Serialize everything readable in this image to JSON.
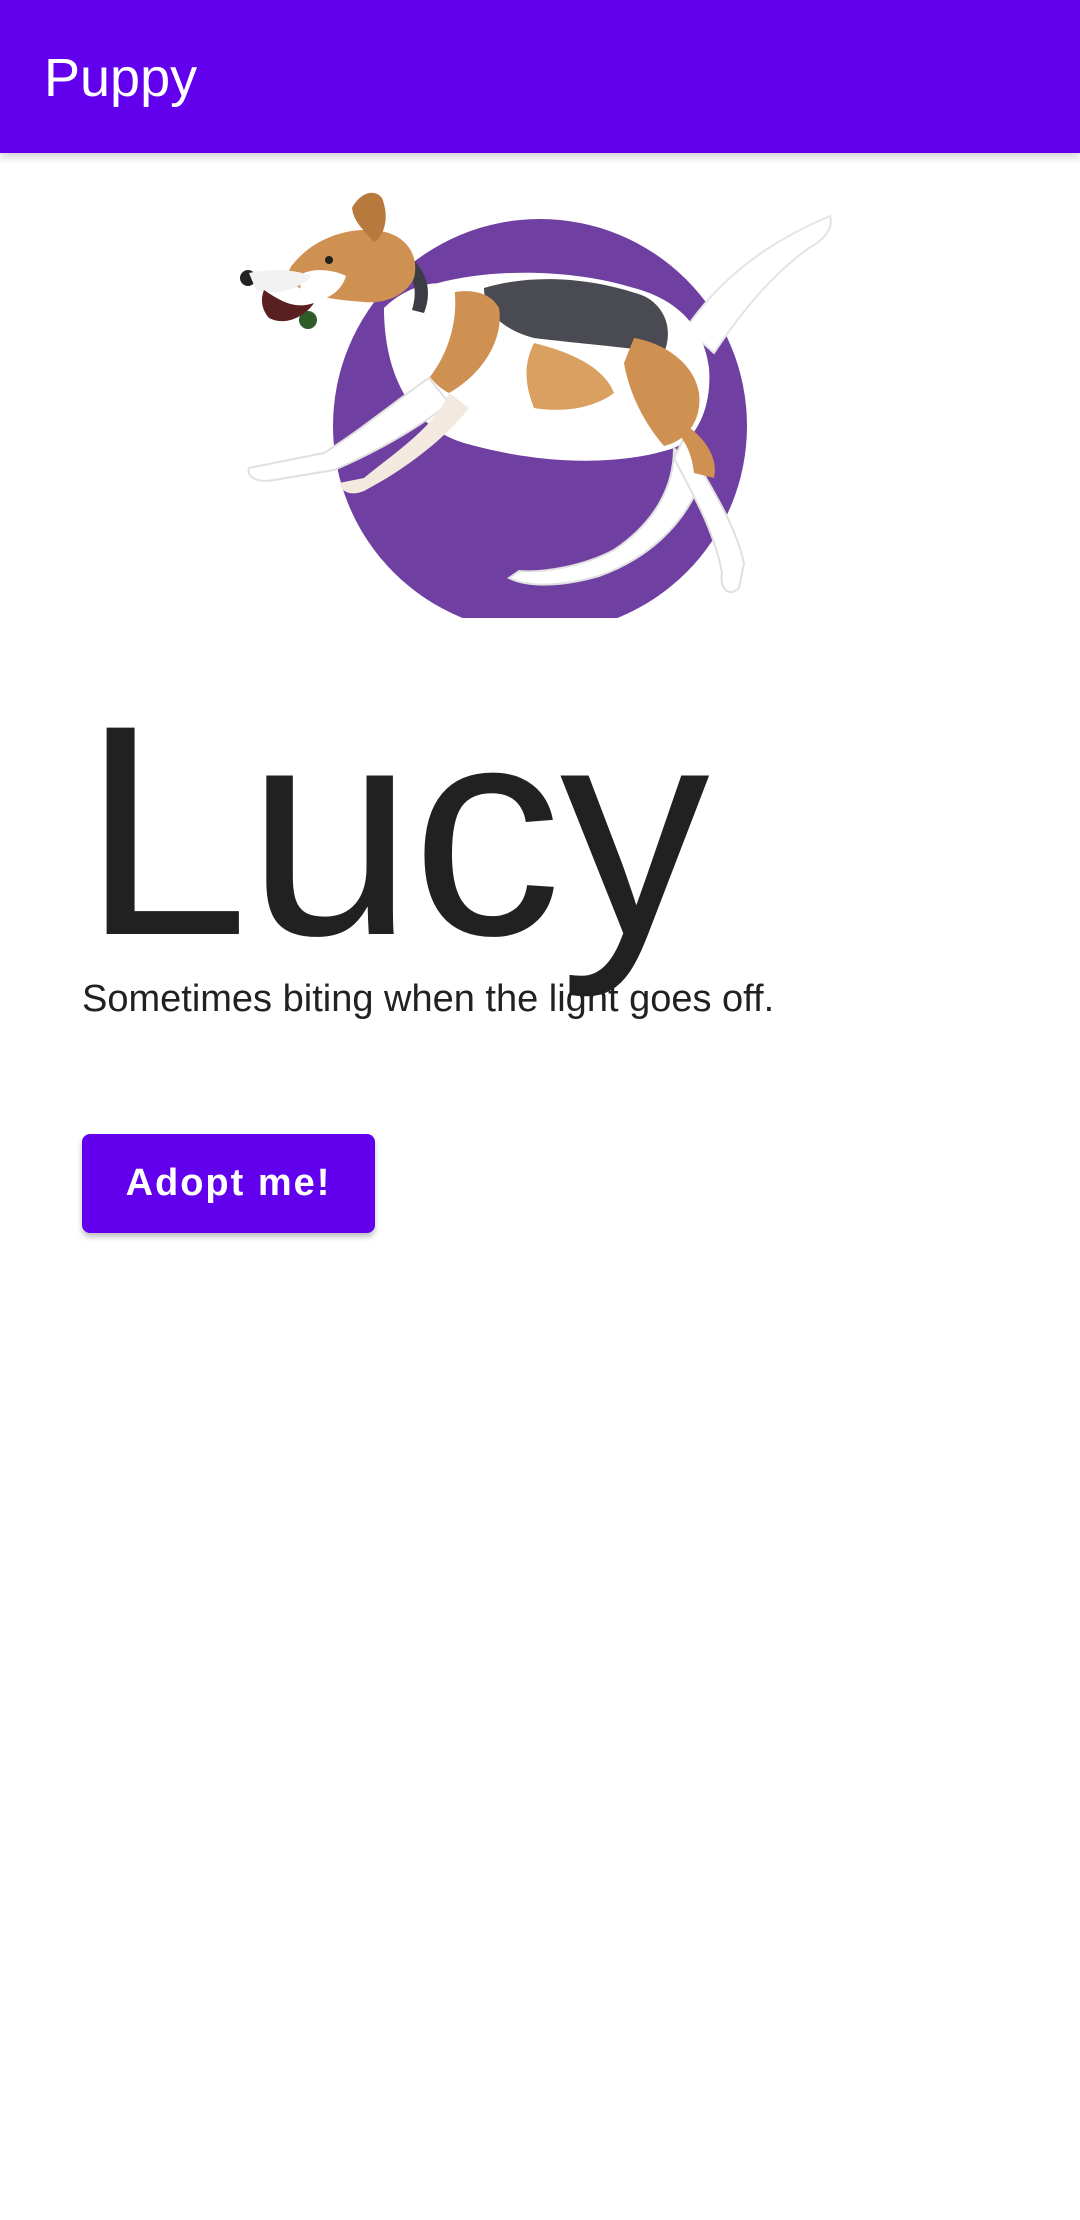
{
  "app_bar": {
    "title": "Puppy"
  },
  "pet": {
    "name": "Lucy",
    "description": "Sometimes biting when the light goes off.",
    "image_icon": "dog-photo-icon"
  },
  "actions": {
    "adopt_label": "Adopt me!"
  },
  "colors": {
    "primary": "#6200ee",
    "image_circle": "#6f40a1",
    "text": "#212121",
    "on_primary": "#ffffff"
  }
}
